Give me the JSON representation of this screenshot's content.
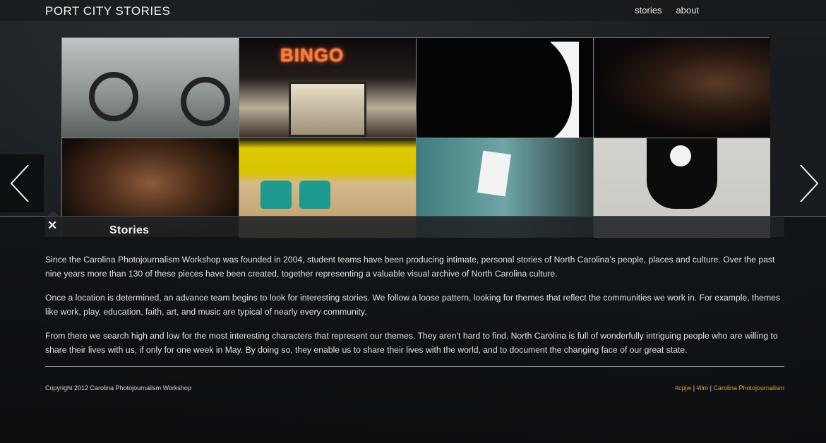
{
  "header": {
    "site_title": "PORT CITY STORIES",
    "nav": [
      {
        "label": "stories"
      },
      {
        "label": "about"
      }
    ]
  },
  "grid": {
    "tiles": [
      {
        "alt": "wheelchair"
      },
      {
        "alt": "bingo hall",
        "sign_text": "BINGO"
      },
      {
        "alt": "silhouette profile"
      },
      {
        "alt": "portrait in shadow"
      },
      {
        "alt": "man portrait"
      },
      {
        "alt": "roller skates"
      },
      {
        "alt": "name badge"
      },
      {
        "alt": "child lying on ground"
      }
    ]
  },
  "panel": {
    "title": "Stories",
    "close_icon": "close-icon",
    "paragraphs": [
      "Since the Carolina Photojournalism Workshop was founded in 2004, student teams have been producing intimate, personal stories of North Carolina’s people, places and culture. Over the past nine years more than 130 of these pieces have been created, together representing a valuable visual archive of North Carolina culture.",
      "Once a location is determined, an advance team begins to look for interesting stories. We follow a loose pattern, looking for themes that reflect the communities we work in. For example, themes like work, play, education, faith, art, and music are typical of nearly every community.",
      "From there we search high and low for the most interesting characters that represent our themes. They aren’t hard to find. North Carolina is full of wonderfully intriguing people who are willing to share their lives with us, if only for one week in May. By doing so, they enable us to share their lives with the world, and to document the changing face of our great state."
    ]
  },
  "footer": {
    "copyright": "Copyright 2012 Carolina Photojournalism Workshop",
    "links": [
      {
        "label": "#cpjw"
      },
      {
        "label": "#ilm"
      },
      {
        "label": "Carolina Photojournalism"
      }
    ],
    "separator": "|",
    "link_color": "#d9a53a"
  },
  "arrows": {
    "left_icon": "chevron-left-icon",
    "right_icon": "chevron-right-icon"
  }
}
